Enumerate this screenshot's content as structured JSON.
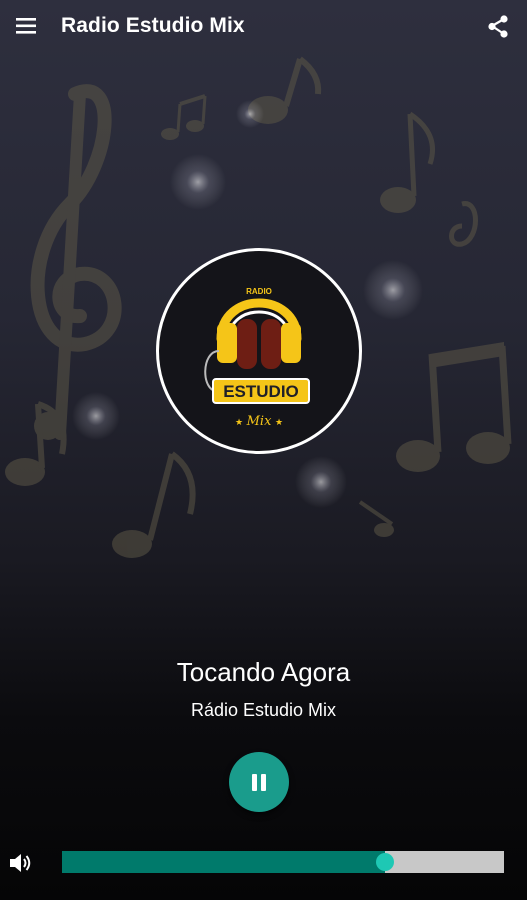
{
  "toolbar": {
    "menu_icon": "hamburger-menu-icon",
    "title": "Radio Estudio Mix",
    "share_icon": "share-icon"
  },
  "logo": {
    "top_text": "RADIO",
    "main_text": "ESTUDIO",
    "script_text": "Mix",
    "accent_color": "#f5c518"
  },
  "player": {
    "now_playing_label": "Tocando Agora",
    "station_name": "Rádio Estudio Mix",
    "state": "playing",
    "control_icon": "pause-icon",
    "accent_color": "#1a9c8c"
  },
  "volume": {
    "icon": "volume-icon",
    "level": 0.73
  }
}
